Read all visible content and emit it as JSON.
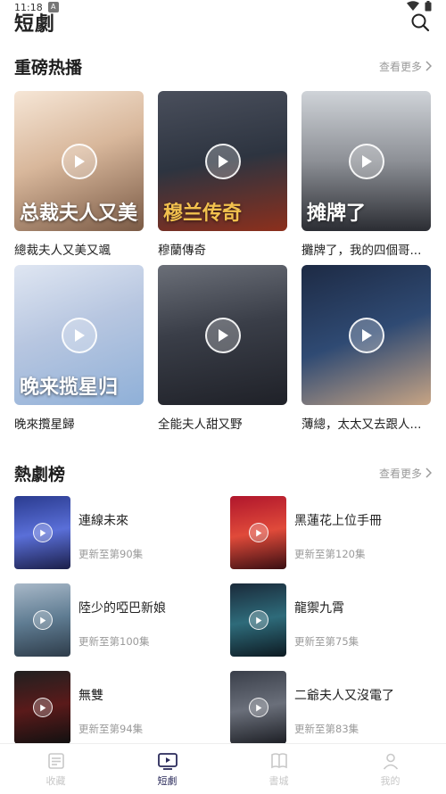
{
  "status_bar": {
    "time": "11:18",
    "badge": "A"
  },
  "header": {
    "title": "短劇"
  },
  "featured": {
    "title": "重磅热播",
    "see_more": "查看更多",
    "items": [
      {
        "title": "總裁夫人又美又颯",
        "caption": "总裁夫人又美又飒"
      },
      {
        "title": "穆蘭傳奇",
        "caption": "穆兰传奇"
      },
      {
        "title": "攤牌了，我的四個哥...",
        "caption": "摊牌了"
      },
      {
        "title": "晚來攬星歸",
        "caption": "晚来揽星归"
      },
      {
        "title": "全能夫人甜又野",
        "caption": ""
      },
      {
        "title": "薄總，太太又去跟人...",
        "caption": ""
      }
    ]
  },
  "hot": {
    "title": "熱劇榜",
    "see_more": "查看更多",
    "items": [
      {
        "title": "連線未來",
        "update": "更新至第90集"
      },
      {
        "title": "黑蓮花上位手冊",
        "update": "更新至第120集"
      },
      {
        "title": "陸少的啞巴新娘",
        "update": "更新至第100集"
      },
      {
        "title": "龍禦九霄",
        "update": "更新至第75集"
      },
      {
        "title": "無雙",
        "update": "更新至第94集"
      },
      {
        "title": "二爺夫人又沒電了",
        "update": "更新至第83集"
      }
    ]
  },
  "tabs": [
    {
      "label": "收藏",
      "icon": "list-icon"
    },
    {
      "label": "短劇",
      "icon": "tv-icon"
    },
    {
      "label": "書城",
      "icon": "book-icon"
    },
    {
      "label": "我的",
      "icon": "user-icon"
    }
  ],
  "colors": {
    "accent": "#2a2a5a",
    "muted": "#9a9a9a",
    "inactive_tab": "#c8c8c8"
  }
}
